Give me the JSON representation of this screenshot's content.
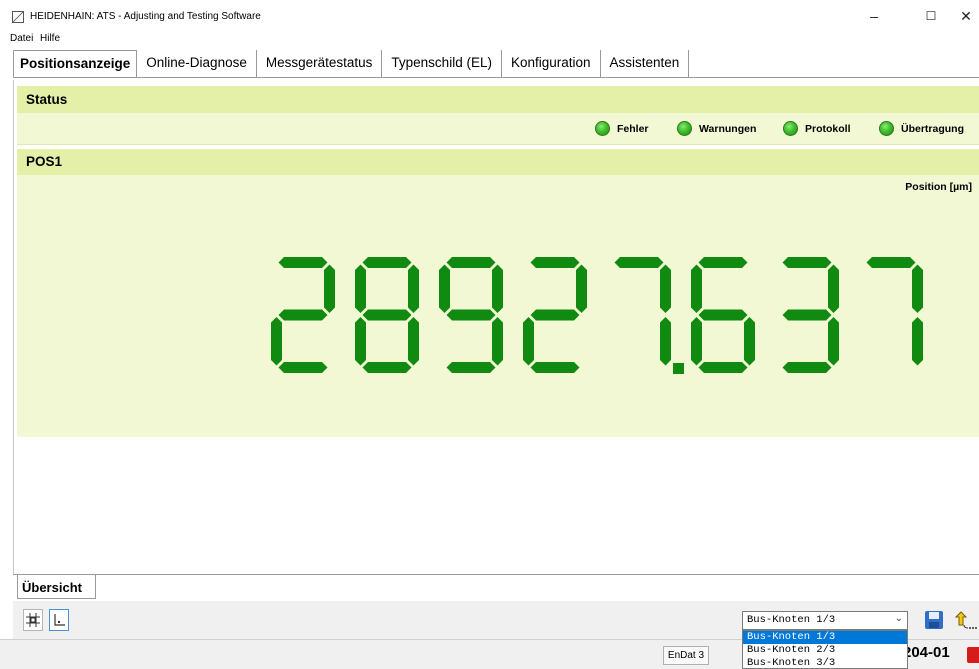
{
  "window": {
    "title": "HEIDENHAIN: ATS - Adjusting and Testing Software",
    "minimize": "–",
    "maximize": "☐",
    "close": "✕"
  },
  "menu": {
    "items": [
      "Datei",
      "Hilfe"
    ]
  },
  "tabs": [
    {
      "label": "Positionsanzeige",
      "active": true
    },
    {
      "label": "Online-Diagnose"
    },
    {
      "label": "Messgerätestatus"
    },
    {
      "label": "Typenschild (EL)"
    },
    {
      "label": "Konfiguration"
    },
    {
      "label": "Assistenten"
    }
  ],
  "status": {
    "header": "Status",
    "indicators": [
      {
        "label": "Fehler",
        "color": "#3fbf2b"
      },
      {
        "label": "Warnungen",
        "color": "#3fbf2b"
      },
      {
        "label": "Protokoll",
        "color": "#3fbf2b"
      },
      {
        "label": "Übertragung",
        "color": "#3fbf2b"
      }
    ]
  },
  "position": {
    "header": "POS1",
    "unit": "Position [µm]",
    "value": "28927.637",
    "digit_color": "#108a10"
  },
  "overview_tab": "Übersicht",
  "toolbar": {
    "icons": [
      "grid-icon",
      "axis-icon"
    ],
    "bus_node_selected": "Bus-Knoten 1/3",
    "bus_node_options": [
      "Bus-Knoten 1/3",
      "Bus-Knoten 2/3",
      "Bus-Knoten 3/3"
    ]
  },
  "statusbar": {
    "interface": "EnDat 3",
    "code": "204-01"
  }
}
